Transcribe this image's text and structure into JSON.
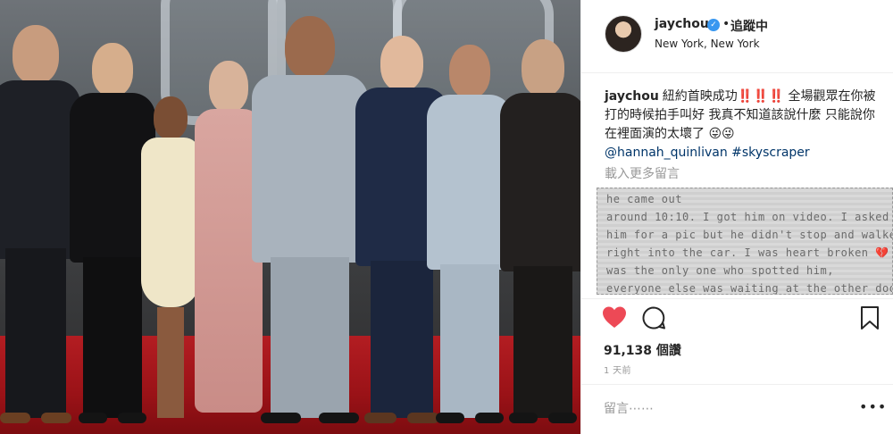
{
  "photo": {
    "alt_subject": "group-photo-red-carpet",
    "colors": {
      "carpet": "#a3171c",
      "backdrop": "#55595c"
    }
  },
  "header": {
    "username": "jaychou",
    "verified_glyph": "✓",
    "separator": "•",
    "follow_label": "追蹤中",
    "location": "New York, New York"
  },
  "caption": {
    "username": "jaychou",
    "text": "紐約首映成功‼️‼️‼️ 全場觀眾在你被打的時候拍手叫好 我真不知道該說什麼 只能說你在裡面演的太壞了 😜😜",
    "mention": "@hannah_quinlivan",
    "hashtag": "#skyscraper"
  },
  "load_more_label": "載入更多留言",
  "overlay_comment": {
    "lines": [
      "                              he came out",
      "around 10:10. I got him on video. I asked",
      "him for a pic but he didn't stop and walked",
      "right into the car. I was heart broken 💔 I",
      "was the only one who spotted him,",
      "everyone else was waiting at the other door"
    ]
  },
  "actions": {
    "like_icon": "heart-icon",
    "comment_icon": "comment-icon",
    "save_icon": "bookmark-icon",
    "like_color": "#ed4956"
  },
  "stats": {
    "likes_label": "91,138 個讚",
    "time_ago": "1 天前"
  },
  "comment_input": {
    "placeholder": "留言⋯⋯",
    "more_label": "•••"
  }
}
